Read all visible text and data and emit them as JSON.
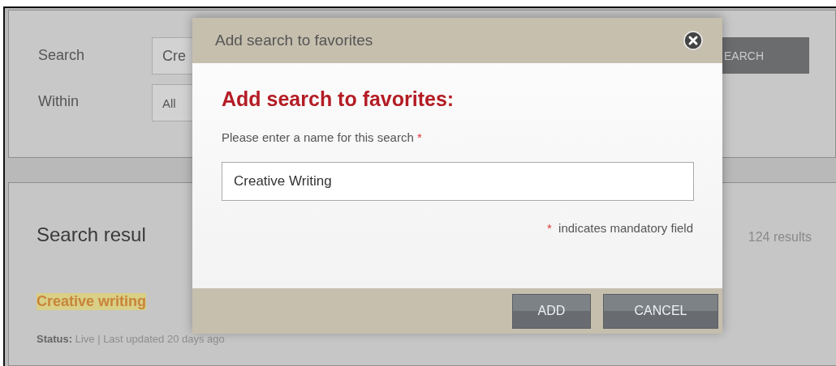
{
  "search_form": {
    "fields": [
      {
        "label": "Search",
        "value": "Cre"
      },
      {
        "label": "Within",
        "value": "All"
      }
    ],
    "button": "EARCH"
  },
  "results": {
    "heading": "Search resul",
    "count": "124 results",
    "items": [
      {
        "title": "Creative writing",
        "highlighted": true,
        "status_label": "Status:",
        "status": "Live | Last updated 20 days ago"
      }
    ]
  },
  "dialog": {
    "title": "Add search to favorites",
    "heading": "Add search to favorites:",
    "field_label": "Please enter a name for this search",
    "required_mark": "*",
    "value": "Creative Writing",
    "mandatory_note": "indicates mandatory field",
    "buttons": [
      "ADD",
      "CANCEL"
    ]
  }
}
